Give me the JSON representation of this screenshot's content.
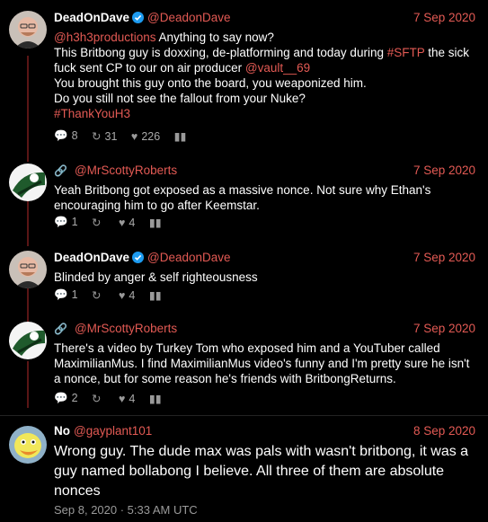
{
  "tweets": [
    {
      "name": "DeadOnDave",
      "handle": "@DeadonDave",
      "date": "7 Sep 2020",
      "lines": [
        [
          {
            "t": "@h3h3productions",
            "red": true
          },
          {
            "t": " Anything to say now?",
            "red": false
          }
        ],
        [
          {
            "t": "This Britbong guy is doxxing, de-platforming and today during ",
            "red": false
          },
          {
            "t": "#SFTP",
            "red": true
          },
          {
            "t": " the sick",
            "red": false
          }
        ],
        [
          {
            "t": "fuck sent CP to our on air producer ",
            "red": false
          },
          {
            "t": "@vault__69",
            "red": true
          }
        ],
        [
          {
            "t": "You brought this guy onto the board, you weaponized him.",
            "red": false
          }
        ],
        [
          {
            "t": "Do you still not see the fallout from your Nuke?",
            "red": false
          }
        ],
        [
          {
            "t": "#ThankYouH3",
            "red": true
          }
        ]
      ],
      "replies": "8",
      "retweets": "31",
      "likes": "226"
    },
    {
      "name": "",
      "handle": "@MrScottyRoberts",
      "date": "7 Sep 2020",
      "lines": [
        [
          {
            "t": "Yeah Britbong got exposed as a massive nonce. Not sure why Ethan's",
            "red": false
          }
        ],
        [
          {
            "t": "encouraging him to go after Keemstar.",
            "red": false
          }
        ]
      ],
      "replies": "1",
      "retweets": "",
      "likes": "4"
    },
    {
      "name": "DeadOnDave",
      "handle": "@DeadonDave",
      "date": "7 Sep 2020",
      "lines": [
        [
          {
            "t": "Blinded by anger & self righteousness",
            "red": false
          }
        ]
      ],
      "replies": "1",
      "retweets": "",
      "likes": "4"
    },
    {
      "name": "",
      "handle": "@MrScottyRoberts",
      "date": "7 Sep 2020",
      "lines": [
        [
          {
            "t": "There's a video by Turkey Tom who exposed him and a YouTuber called",
            "red": false
          }
        ],
        [
          {
            "t": "MaximilianMus. I find MaximilianMus video's funny and I'm pretty sure he isn't",
            "red": false
          }
        ],
        [
          {
            "t": "a nonce, but for some reason he's friends with BritbongReturns.",
            "red": false
          }
        ]
      ],
      "replies": "2",
      "retweets": "",
      "likes": "4"
    },
    {
      "name": "No",
      "handle": "@gayplant101",
      "date": "8 Sep 2020",
      "lines": [
        [
          {
            "t": "Wrong guy. The dude max was pals with wasn't britbong, it was a",
            "red": false
          }
        ],
        [
          {
            "t": "guy named bollabong I believe. All three of them are absolute",
            "red": false
          }
        ],
        [
          {
            "t": "nonces",
            "red": false
          }
        ]
      ],
      "timestamp": "Sep 8, 2020 · 5:33 AM UTC"
    }
  ],
  "colors": {
    "accent": "#e35a54",
    "verified": "#1d9bf0",
    "background": "#000000"
  },
  "icons": [
    "verified-badge-icon",
    "link-icon",
    "reply-icon",
    "retweet-icon",
    "like-icon",
    "stats-icon"
  ]
}
